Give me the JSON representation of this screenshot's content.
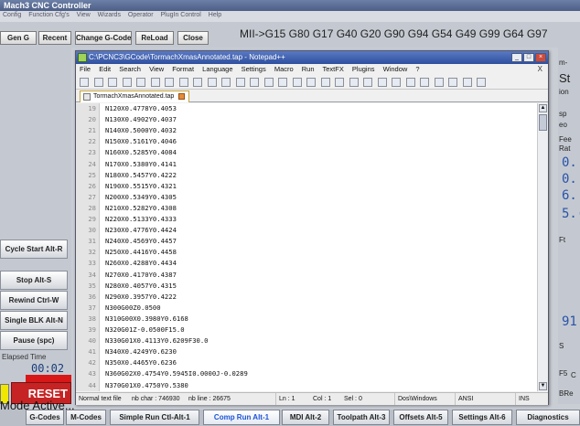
{
  "mach": {
    "title": "Mach3 CNC Controller",
    "menu": [
      "Config",
      "Function Cfg's",
      "View",
      "Wizards",
      "Operator",
      "PlugIn Control",
      "Help"
    ],
    "toolbar_buttons": [
      "Gen G",
      "Recent",
      "Change G-Code",
      "ReLoad",
      "Close"
    ],
    "gcode_modal": "MII->G15  G80 G17 G40 G20 G90 G94 G54 G49 G99 G64 G97",
    "side_buttons": [
      "Cycle Start Alt-R",
      "Stop Alt-S",
      "Rewind Ctrl-W",
      "Single BLK Alt-N",
      "Pause (spc)"
    ],
    "elapsed_label": "Elapsed Time",
    "elapsed_value": "00:02",
    "reset_label": "RESET",
    "mode_text": "Mode Active...",
    "right_panel": {
      "items": [
        "m-",
        "St",
        "ion",
        "sp",
        "eo",
        "Fee",
        "Rat"
      ],
      "dro": [
        "0.",
        "0.",
        "6.",
        "5.(",
        "91"
      ],
      "labels": [
        "Ft",
        "S",
        "F5",
        "C",
        "BRe"
      ]
    },
    "tabs": [
      {
        "label": "G-Codes",
        "active": false
      },
      {
        "label": "M-Codes",
        "active": false
      },
      {
        "label": "Simple Run Ctl-Alt-1",
        "active": false
      },
      {
        "label": "Comp Run Alt-1",
        "active": true
      },
      {
        "label": "MDI Alt-2",
        "active": false
      },
      {
        "label": "Toolpath Alt-3",
        "active": false
      },
      {
        "label": "Offsets Alt-5",
        "active": false
      },
      {
        "label": "Settings Alt-6",
        "active": false
      },
      {
        "label": "Diagnostics",
        "active": false
      }
    ]
  },
  "npp": {
    "title": "C:\\PCNC3\\GCode\\TormachXmasAnnotated.tap - Notepad++",
    "menu": [
      "File",
      "Edit",
      "Search",
      "View",
      "Format",
      "Language",
      "Settings",
      "Macro",
      "Run",
      "TextFX",
      "Plugins",
      "Window",
      "?"
    ],
    "menu_close": "X",
    "file_tab": "TormachXmasAnnotated.tap",
    "lines": [
      {
        "n": "19",
        "code": "N120X0.4778Y0.4053"
      },
      {
        "n": "20",
        "code": "N130X0.4902Y0.4037"
      },
      {
        "n": "21",
        "code": "N140X0.5000Y0.4032"
      },
      {
        "n": "22",
        "code": "N150X0.5161Y0.4046"
      },
      {
        "n": "23",
        "code": "N160X0.5285Y0.4084"
      },
      {
        "n": "24",
        "code": "N170X0.5380Y0.4141"
      },
      {
        "n": "25",
        "code": "N180X0.5457Y0.4222"
      },
      {
        "n": "26",
        "code": "N190X0.5515Y0.4321"
      },
      {
        "n": "27",
        "code": "N200X0.5349Y0.4305"
      },
      {
        "n": "28",
        "code": "N210X0.5282Y0.4308"
      },
      {
        "n": "29",
        "code": "N220X0.5133Y0.4333"
      },
      {
        "n": "30",
        "code": "N230X0.4776Y0.4424"
      },
      {
        "n": "31",
        "code": "N240X0.4569Y0.4457"
      },
      {
        "n": "32",
        "code": "N250X0.4416Y0.4458"
      },
      {
        "n": "33",
        "code": "N260X0.4288Y0.4434"
      },
      {
        "n": "34",
        "code": "N270X0.4170Y0.4387"
      },
      {
        "n": "35",
        "code": "N280X0.4057Y0.4315"
      },
      {
        "n": "36",
        "code": "N290X0.3957Y0.4222"
      },
      {
        "n": "37",
        "code": "N300G00Z0.0500"
      },
      {
        "n": "38",
        "code": "N310G00X0.3980Y0.6168"
      },
      {
        "n": "39",
        "code": "N320G01Z-0.0500F15.0"
      },
      {
        "n": "40",
        "code": "N330G01X0.4113Y0.6209F30.0"
      },
      {
        "n": "41",
        "code": "N340X0.4249Y0.6230"
      },
      {
        "n": "42",
        "code": "N350X0.4465Y0.6236"
      },
      {
        "n": "43",
        "code": "N360G02X0.4754Y0.5945I0.0000J-0.0289"
      },
      {
        "n": "44",
        "code": "N370G01X0.4750Y0.5380"
      }
    ],
    "status": {
      "type": "Normal text file",
      "nb_char": "nb char : 746930",
      "nb_line": "nb line : 26675",
      "ln": "Ln : 1",
      "col": "Col : 1",
      "sel": "Sel : 0",
      "eol": "Dos\\Windows",
      "encoding": "ANSI",
      "mode": "INS"
    }
  }
}
